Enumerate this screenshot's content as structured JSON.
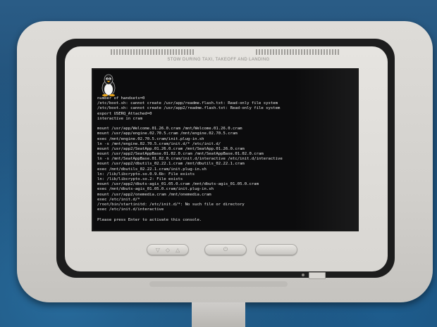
{
  "bezel": {
    "stow_label": "STOW DURING TAXI, TAKEOFF AND LANDING"
  },
  "console": {
    "lines": [
      "number of handsets=0",
      "/etc/boot.sh: cannot create /usr/app/readme.flash.txt: Read-only file system",
      "/etc/boot.sh: cannot create /usr/app2/readme.flash.txt: Read-only file system",
      "export USERQ_Attached=0",
      "interactive in cram",
      "",
      "mount /usr/app/Welcome.01.26.0.cram /mnt/Welcome.01.26.0.cram",
      "mount /usr/app/engine.02.70.5.cram /mnt/engine.02.70.5.cram",
      "exec /mnt/engine.02.70.5.cram/init.plug-in.sh",
      "ln -s /mnt/engine.02.70.5.cram/init.d/* /etc/init.d/",
      "mount /usr/app2/SeatApp.01.26.0.cram /mnt/SeatApp.01.26.0.cram",
      "mount /usr/app2/SeatAppBase.01.02.0.cram /mnt/SeatAppBase.01.02.0.cram",
      "ln -s /mnt/SeatAppBase.01.02.0.cram/init.d/interactive /etc/init.d/interactive",
      "mount /usr/app2/dbutils_02.22.1.cram /mnt/dbutils_02.22.1.cram",
      "exec /mnt/dbutils_02.22.1.cram/init.plug-in.sh",
      "ln: /lib/libcrypto.so.0.9.6b: File exists",
      "ln: /lib/libcrypto.so.2: File exists",
      "mount /usr/app2/dbuts-agis_01.05.0.cram /mnt/dbuts-agis_01.05.0.cram",
      "exec /mnt/dbuts-agis_01.05.0.cram/init.plug-in.sh",
      "mount /usr/app2/onemedia.cram /mnt/onemedia.cram",
      "exec /etc/init.d/*",
      "/root/bin/startinitd: /etc/init.d/*: No such file or directory",
      "exec /etc/init.d/interactive",
      "",
      "Please press Enter to activate this console."
    ]
  },
  "controls": {
    "left_button_icons": [
      "▽",
      "◇",
      "△"
    ],
    "power_icon": "⏻"
  },
  "colors": {
    "bezel": "#d8d6d2",
    "screen": "#0c0c0d",
    "console_text": "#e8e8e8",
    "seat_fabric": "#1f4f78"
  }
}
